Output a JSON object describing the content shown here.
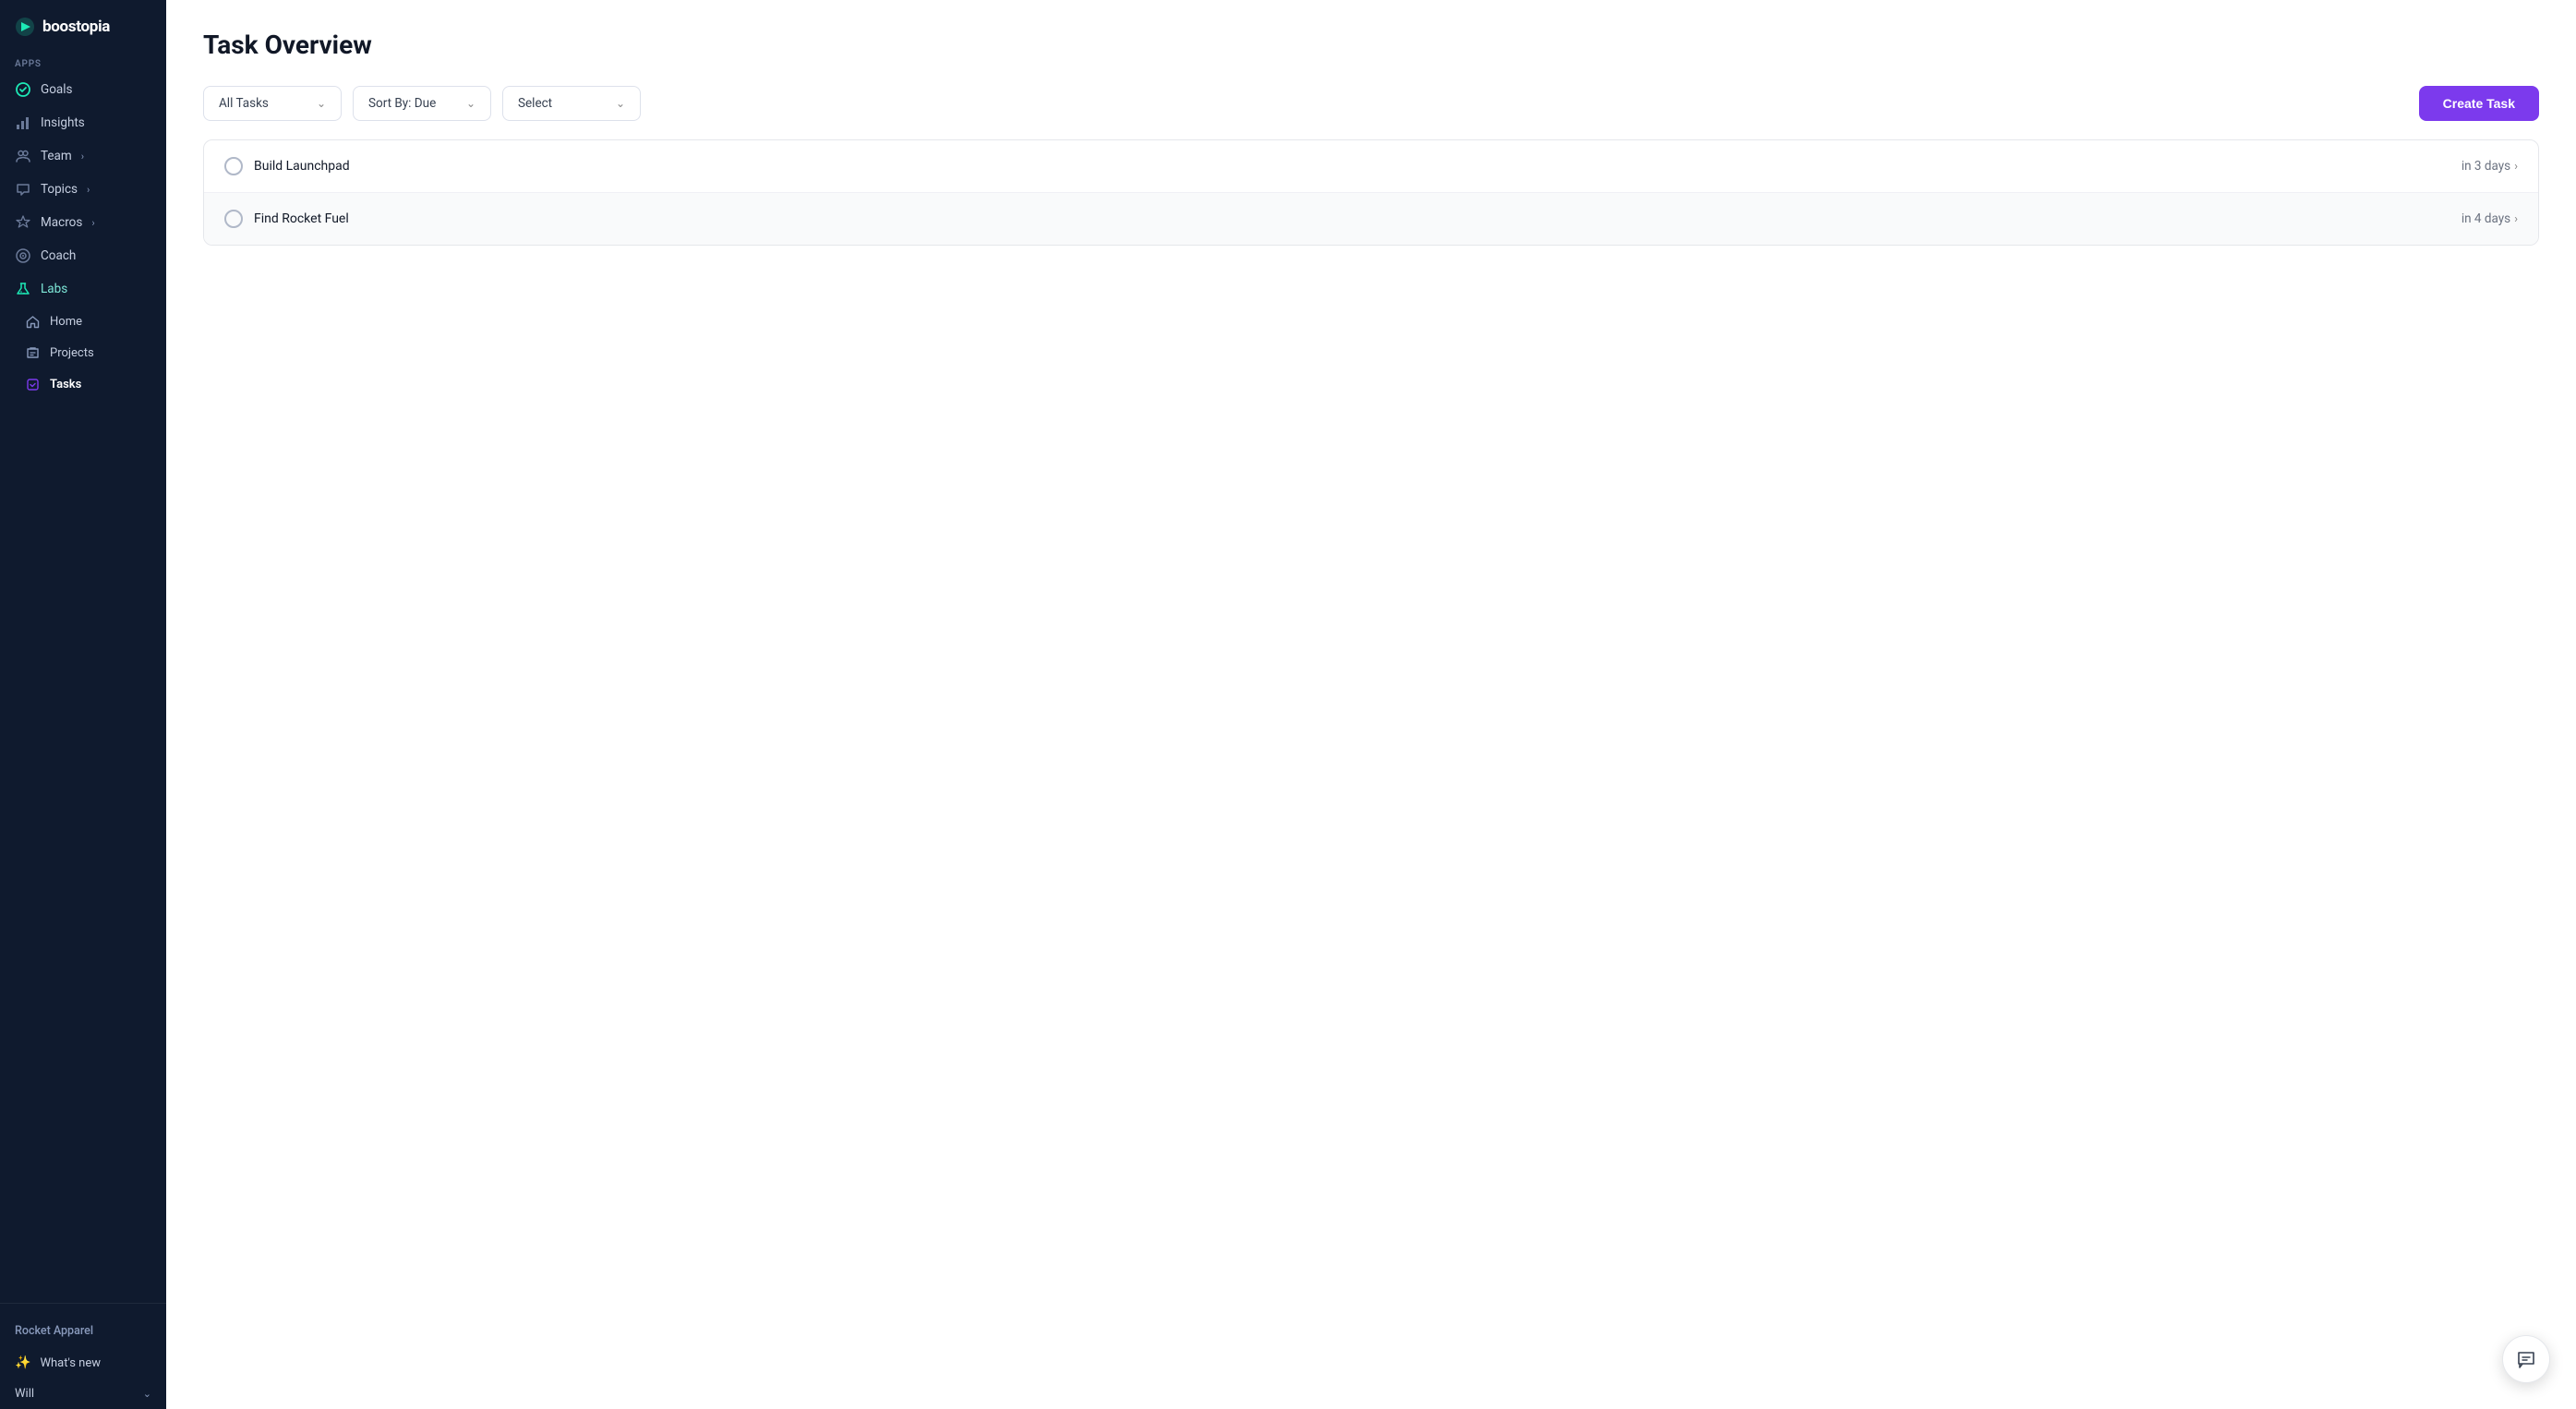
{
  "app": {
    "name": "boostopia"
  },
  "sidebar": {
    "section_label": "APPS",
    "items": [
      {
        "id": "goals",
        "label": "Goals",
        "icon": "✓",
        "icon_type": "check-circle",
        "active": false
      },
      {
        "id": "insights",
        "label": "Insights",
        "icon": "📊",
        "icon_type": "bar-chart",
        "active": false
      },
      {
        "id": "team",
        "label": "Team",
        "icon": "👥",
        "icon_type": "team",
        "active": false,
        "hasChevron": true
      },
      {
        "id": "topics",
        "label": "Topics",
        "icon": "💬",
        "icon_type": "topics",
        "active": false,
        "hasChevron": true
      },
      {
        "id": "macros",
        "label": "Macros",
        "icon": "⚡",
        "icon_type": "macros",
        "active": false,
        "hasChevron": true
      },
      {
        "id": "coach",
        "label": "Coach",
        "icon": "🎯",
        "icon_type": "coach",
        "active": false
      },
      {
        "id": "labs",
        "label": "Labs",
        "icon": "🧪",
        "icon_type": "labs",
        "active": true
      }
    ],
    "sub_items": [
      {
        "id": "home",
        "label": "Home",
        "icon": "🏠",
        "icon_type": "home"
      },
      {
        "id": "projects",
        "label": "Projects",
        "icon": "🔗",
        "icon_type": "projects"
      },
      {
        "id": "tasks",
        "label": "Tasks",
        "icon": "📋",
        "icon_type": "tasks",
        "active": true
      }
    ],
    "bottom": {
      "org": "Rocket Apparel",
      "whats_new": "What's new",
      "will": "Will"
    }
  },
  "main": {
    "page_title": "Task Overview",
    "toolbar": {
      "filter_label": "All Tasks",
      "sort_label": "Sort By: Due",
      "select_label": "Select",
      "create_task_label": "Create Task"
    },
    "tasks": [
      {
        "id": 1,
        "name": "Build Launchpad",
        "due": "in 3 days"
      },
      {
        "id": 2,
        "name": "Find Rocket Fuel",
        "due": "in 4 days"
      }
    ]
  },
  "chat_button": {
    "icon": "💬",
    "label": "Chat"
  }
}
